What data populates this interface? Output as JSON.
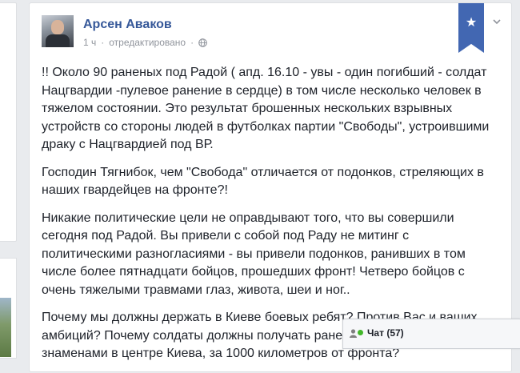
{
  "post": {
    "author": "Арсен Аваков",
    "time": "1 ч",
    "separator": "·",
    "edited": "отредактировано",
    "paragraphs": [
      "!! Около 90 раненых под Радой ( апд. 16.10 - увы - один погибший - солдат Нацгвардии -пулевое ранение в сердце) в том числе несколько человек в тяжелом состоянии. Это результат брошенных нескольких взрывных устройств со стороны людей в футболках партии \"Свободы\", устроившими драку с Нацгвардией под ВР.",
      "Господин Тягнибок, чем \"Свобода\" отличается от подонков, стреляющих в наших гвардейцев на фронте?!",
      "Никакие политические цели не оправдывают того, что вы совершили сегодня под Радой. Вы привели с собой под Раду не митинг с политическими разногласиями - вы привели подонков, ранивших в том числе более пятнадцати бойцов, прошедших фронт! Четверо бойцов с очень тяжелыми травмами глаз, живота, шеи и ног..",
      "Почему мы должны держать в Киеве боевых ребят? Против Вас и ваших амбиций? Почему солдаты должны получать ранения под вашими знаменами в центре Киева, за 1000 километров от фронта?"
    ]
  },
  "bookmark": {
    "symbol": "★",
    "color": "#4267b2"
  },
  "chat": {
    "label": "Чат (57)",
    "status_color": "#42b72a"
  },
  "icons": {
    "privacy": "globe-icon",
    "menu": "chevron-down-icon",
    "chat_user": "user-icon"
  }
}
